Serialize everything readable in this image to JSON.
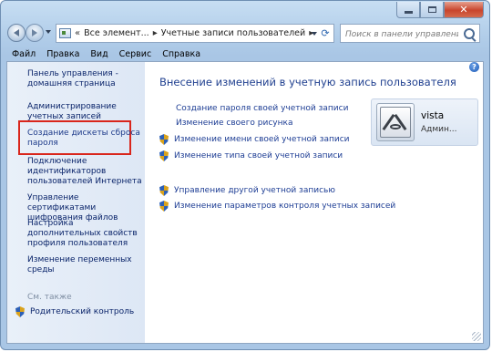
{
  "window": {
    "controls": {
      "minimize": "",
      "maximize": "",
      "close": "✕"
    }
  },
  "address": {
    "overflow": "«",
    "crumb1": "Все элемент...",
    "crumb2": "Учетные записи пользователей"
  },
  "search": {
    "placeholder": "Поиск в панели управления"
  },
  "menu": [
    "Файл",
    "Правка",
    "Вид",
    "Сервис",
    "Справка"
  ],
  "sidebar": {
    "items": [
      "Панель управления - домашняя страница",
      "Администрирование учетных записей",
      "Создание дискеты сброса пароля",
      "Подключение идентификаторов пользователей Интернета",
      "Управление сертификатами шифрования файлов",
      "Настройка дополнительных свойств профиля пользователя",
      "Изменение переменных среды"
    ],
    "see_also": "См. также",
    "parental": "Родительский контроль"
  },
  "main": {
    "title": "Внесение изменений в учетную запись пользователя",
    "tasks": [
      "Создание пароля своей учетной записи",
      "Изменение своего рисунка",
      "Изменение имени своей учетной записи",
      "Изменение типа своей учетной записи",
      "Управление другой учетной записью",
      "Изменение параметров контроля учетных записей"
    ]
  },
  "user": {
    "name": "vista",
    "role": "Админ..."
  },
  "colors": {
    "highlight": "#d9261c",
    "link": "#1e3b8a",
    "title": "#1f3f8f"
  }
}
